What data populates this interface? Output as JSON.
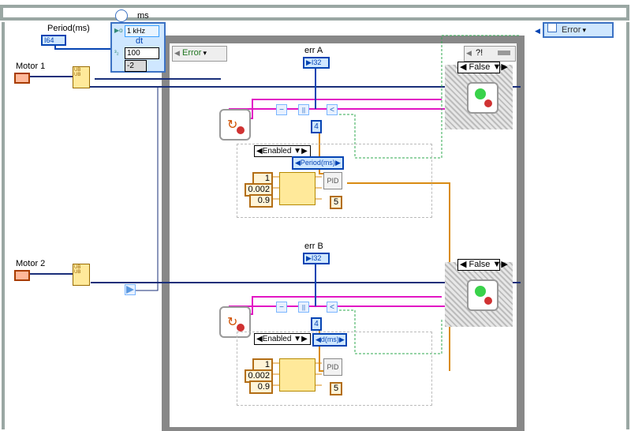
{
  "header": {
    "ms_label": "ms",
    "rate": "1 kHz",
    "dt_label": "dt",
    "dt_val": "100",
    "neg2": "-2",
    "error_pane": "Error",
    "question_item": "?!",
    "error_right": "Error"
  },
  "inputs": {
    "period_label": "Period(ms)",
    "period_type": "I64",
    "motor1_label": "Motor 1",
    "motor2_label": "Motor 2",
    "ub_text": "UB"
  },
  "channelA": {
    "err_label": "err A",
    "err_type": "I32",
    "compare_const": "4",
    "case_false": "False",
    "enabled_label": "Enabled",
    "period_selector": "Period(ms)",
    "pid": {
      "p": "1",
      "i": "0.002",
      "d": "0.9",
      "label": "PID",
      "out": "5"
    }
  },
  "channelB": {
    "err_label": "err B",
    "err_type": "I32",
    "compare_const": "4",
    "case_false": "False",
    "enabled_label": "Enabled",
    "period_selector": "d(ms)",
    "pid": {
      "p": "1",
      "i": "0.002",
      "d": "0.9",
      "label": "PID",
      "out": "5"
    }
  }
}
